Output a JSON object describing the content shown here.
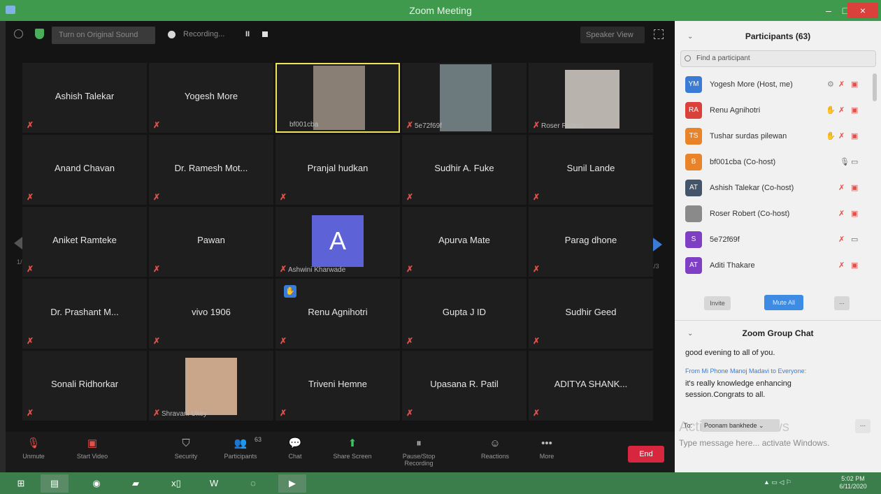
{
  "window": {
    "title": "Zoom Meeting",
    "minimize": "–",
    "maximize": "□",
    "close": "×"
  },
  "topbar": {
    "original_sound": "Turn on Original Sound",
    "recording": "Recording...",
    "pause": "II",
    "speaker_view": "Speaker View"
  },
  "grid": {
    "page": "1/3",
    "tiles": [
      {
        "name": "Ashish Talekar"
      },
      {
        "name": "Yogesh More"
      },
      {
        "name": "",
        "tag": "bf001cba"
      },
      {
        "name": "",
        "tag": "5e72f69f"
      },
      {
        "name": "",
        "tag": "Roser Robert"
      },
      {
        "name": "Anand Chavan"
      },
      {
        "name": "Dr. Ramesh Mot..."
      },
      {
        "name": "Pranjal hudkan"
      },
      {
        "name": "Sudhir A. Fuke"
      },
      {
        "name": "Sunil Lande"
      },
      {
        "name": "Aniket Ramteke"
      },
      {
        "name": "Pawan"
      },
      {
        "name": "",
        "tag": "Ashwini Kharwade",
        "avatar": "A"
      },
      {
        "name": "Apurva Mate"
      },
      {
        "name": "Parag dhone"
      },
      {
        "name": "Dr. Prashant M..."
      },
      {
        "name": "vivo 1906"
      },
      {
        "name": "Renu Agnihotri"
      },
      {
        "name": "Gupta J ID"
      },
      {
        "name": "Sudhir Geed"
      },
      {
        "name": "Sonali Ridhorkar"
      },
      {
        "name": "",
        "tag": "Shravani Ukey"
      },
      {
        "name": "Triveni Hemne"
      },
      {
        "name": "Upasana R. Patil"
      },
      {
        "name": "ADITYA SHANK..."
      }
    ]
  },
  "toolbar": {
    "unmute": "Unmute",
    "start_video": "Start Video",
    "security": "Security",
    "participants": "Participants",
    "participants_count": "63",
    "chat": "Chat",
    "share_screen": "Share Screen",
    "recording": "Pause/Stop Recording",
    "reactions": "Reactions",
    "more": "More",
    "end": "End"
  },
  "participants_panel": {
    "title": "Participants (63)",
    "search_placeholder": "Find a participant",
    "items": [
      {
        "initials": "YM",
        "name": "Yogesh More (Host, me)",
        "color": "#3a7bd5"
      },
      {
        "initials": "RA",
        "name": "Renu Agnihotri",
        "color": "#d9413a"
      },
      {
        "initials": "TS",
        "name": "Tushar surdas pilewan",
        "color": "#e8832a"
      },
      {
        "initials": "B",
        "name": "bf001cba (Co-host)",
        "color": "#e8832a"
      },
      {
        "initials": "AT",
        "name": "Ashish Talekar (Co-host)",
        "color": "#44546a"
      },
      {
        "initials": "",
        "name": "Roser Robert (Co-host)",
        "color": "#8a8a8a"
      },
      {
        "initials": "S",
        "name": "5e72f69f",
        "color": "#7e3fc4"
      },
      {
        "initials": "AT",
        "name": "Aditi Thakare",
        "color": "#7e3fc4"
      }
    ],
    "invite": "Invite",
    "mute_all": "Mute All",
    "more": "..."
  },
  "chat": {
    "title": "Zoom Group Chat",
    "message1": "good evening to all of you.",
    "from_line": "From Mi Phone Manoj Madavi to Everyone:",
    "message2": "it's really knowledge enhancing session.Congrats to all.",
    "to_label": "To:",
    "to_value": "Poonam bankhede ⌄",
    "watermark": "Activate Windows",
    "input_placeholder": "Type message here... activate Windows."
  },
  "taskbar": {
    "clock_time": "5:02 PM",
    "clock_date": "6/11/2020"
  },
  "colors": {
    "title_bar": "#3f9a4e",
    "accent": "#3a7bd5",
    "end": "#d7263d",
    "muted": "#e0514b"
  }
}
